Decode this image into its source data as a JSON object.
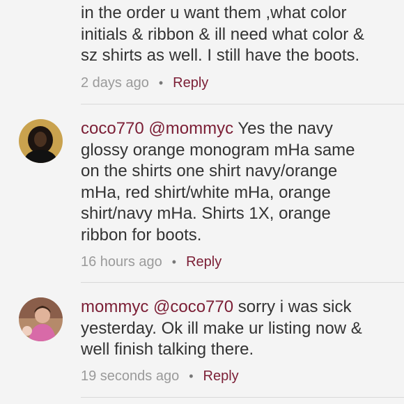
{
  "comments": [
    {
      "text_lines": "in the order u want them ,what color\ninitials & ribbon & ill need what color &\nsz shirts as well. I still have the boots.",
      "timestamp": "2 days ago",
      "reply_label": "Reply"
    },
    {
      "username": "coco770",
      "mention": "@mommyc",
      "text": " Yes the navy\nglossy orange monogram  mHa same\non the shirts one shirt navy/orange\nmHa, red shirt/white mHa, orange\nshirt/navy mHa. Shirts 1X, orange\nribbon for boots.",
      "timestamp": "16 hours ago",
      "reply_label": "Reply"
    },
    {
      "username": "mommyc",
      "mention": "@coco770",
      "text": " sorry i was sick\nyesterday. Ok ill make ur listing now &\nwell finish talking there.",
      "timestamp": "19 seconds ago",
      "reply_label": "Reply"
    }
  ],
  "colors": {
    "accent": "#7b1e35",
    "timestamp": "#9a9a9a",
    "background": "#f4f4f4"
  }
}
